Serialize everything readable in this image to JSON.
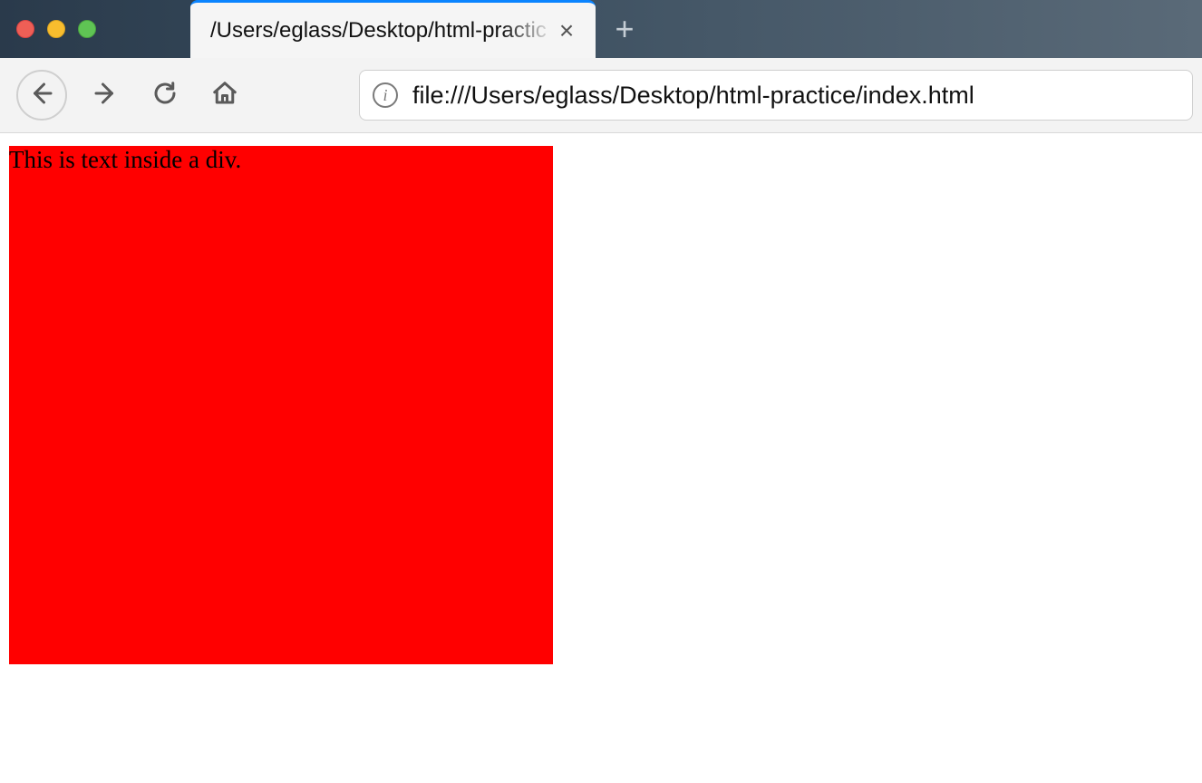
{
  "window": {
    "tab_title": "/Users/eglass/Desktop/html-practic",
    "close_glyph": "×",
    "newtab_glyph": "+"
  },
  "addressbar": {
    "url": "file:///Users/eglass/Desktop/html-practice/index.html",
    "info_glyph": "i"
  },
  "page": {
    "div_text": "This is text inside a div.",
    "div_bg_color": "#ff0000"
  }
}
